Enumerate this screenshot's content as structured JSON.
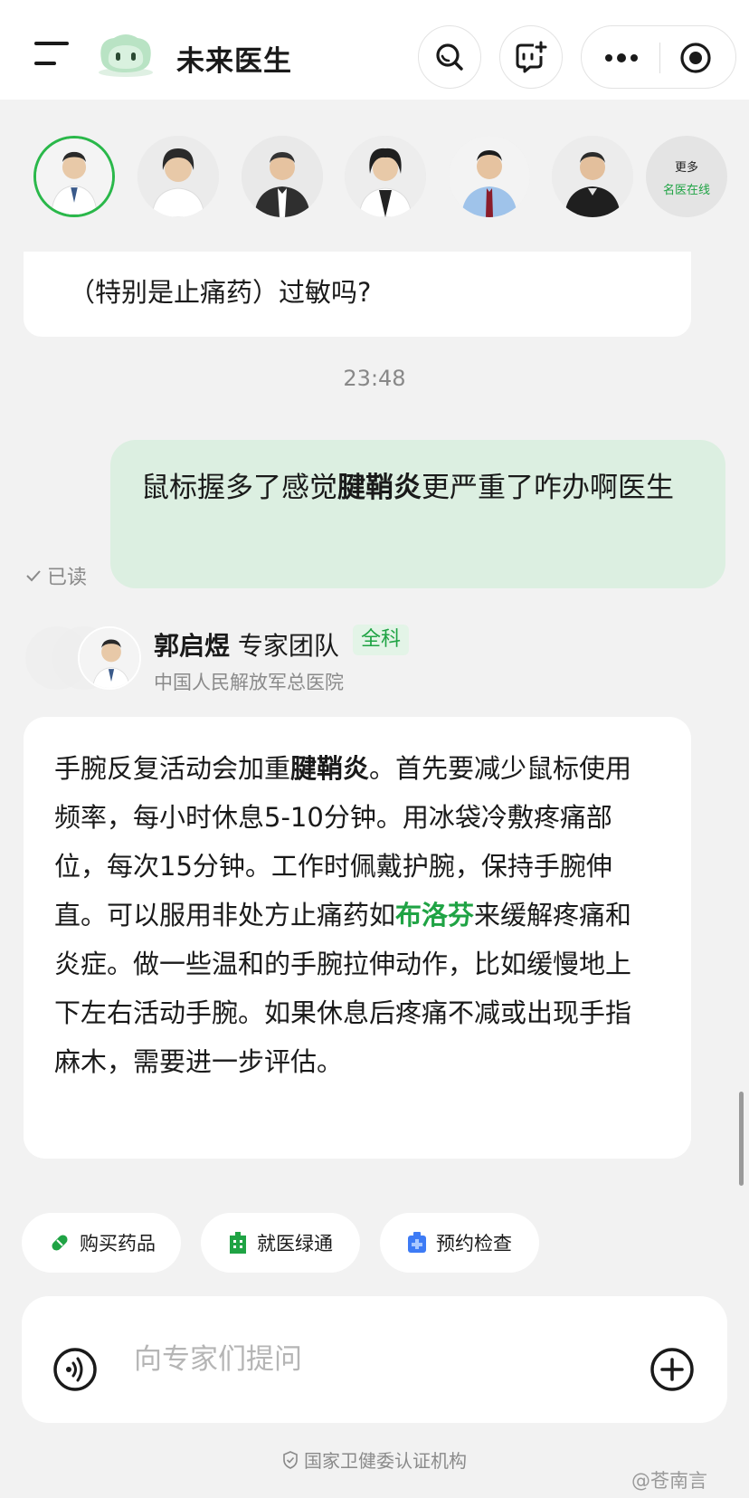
{
  "header": {
    "title": "未来医生",
    "menu_icon": "menu-icon",
    "search_icon": "search-icon",
    "new_chat_icon": "new-chat-icon",
    "more_icon": "more-icon",
    "record_icon": "record-icon"
  },
  "doctor_strip": {
    "more_label_1": "更多",
    "more_label_2": "名医在线"
  },
  "chat": {
    "previous_fragment": "（特别是止痛药）过敏吗?",
    "timestamp": "23:48",
    "user_message_part1": "鼠标握多了感觉",
    "user_message_bold": "腱鞘炎",
    "user_message_part2": "更严重了咋办啊医生",
    "read_status": "已读",
    "doctor": {
      "name": "郭启煜",
      "team": "专家团队",
      "department": "全科",
      "hospital": "中国人民解放军总医院"
    },
    "reply_part1": "手腕反复活动会加重",
    "reply_bold": "腱鞘炎",
    "reply_part2": "。首先要减少鼠标使用频率，每小时休息5-10分钟。用冰袋冷敷疼痛部位，每次15分钟。工作时佩戴护腕，保持手腕伸直。可以服用非处方止痛药如",
    "reply_drug": "布洛芬",
    "reply_part3": "来缓解疼痛和炎症。做一些温和的手腕拉伸动作，比如缓慢地上下左右活动手腕。如果休息后疼痛不减或出现手指麻木，需要进一步评估。"
  },
  "quick_actions": [
    {
      "label": "购买药品",
      "icon": "pill-icon",
      "color": "#1fa344"
    },
    {
      "label": "就医绿通",
      "icon": "hospital-icon",
      "color": "#1fa344"
    },
    {
      "label": "预约检查",
      "icon": "medical-kit-icon",
      "color": "#3d7bf5"
    }
  ],
  "input": {
    "placeholder": "向专家们提问",
    "voice_icon": "voice-icon",
    "plus_icon": "plus-icon"
  },
  "footer": {
    "certification": "国家卫健委认证机构",
    "watermark": "@苍南言"
  },
  "colors": {
    "accent": "#1fa344",
    "user_bubble": "#dcefe1",
    "background": "#f2f2f2"
  }
}
